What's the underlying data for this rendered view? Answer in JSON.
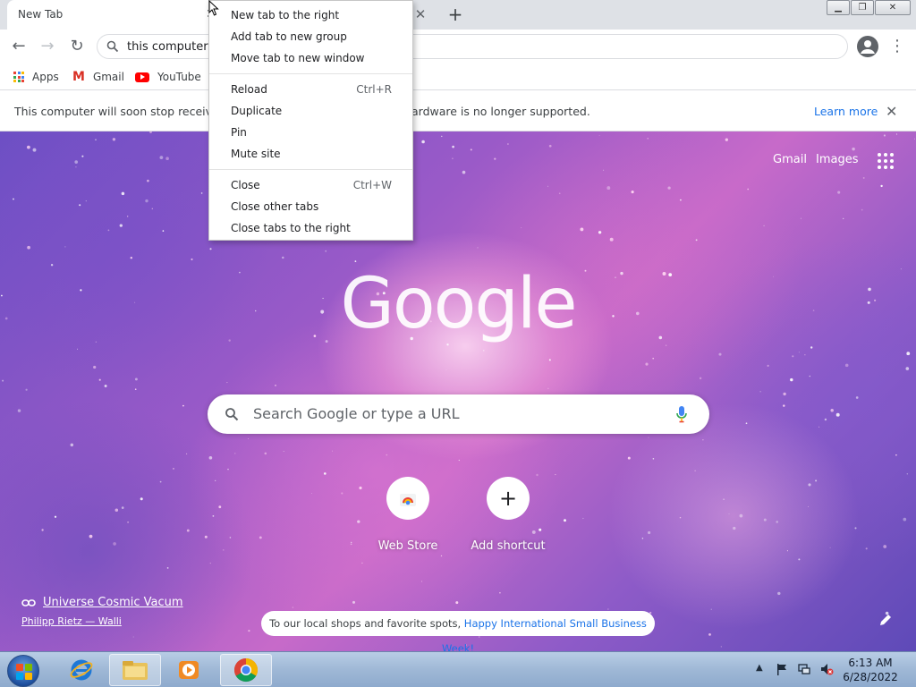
{
  "tabstrip": {
    "active_tab_title": "New Tab",
    "close_glyph": "✕",
    "second_close_glyph": "✕",
    "new_tab_glyph": "+",
    "window_controls": {
      "minimize": "▁",
      "maximize": "❐",
      "close": "✕"
    }
  },
  "toolbar": {
    "back_glyph": "←",
    "forward_glyph": "→",
    "reload_glyph": "↻",
    "omnibox_text": "this computer",
    "profile_icon": "person-icon",
    "menu_glyph": "⋮"
  },
  "bookmarks": [
    {
      "label": "Apps",
      "icon": "apps-grid-icon"
    },
    {
      "label": "Gmail",
      "icon": "gmail-icon"
    },
    {
      "label": "YouTube",
      "icon": "youtube-icon"
    }
  ],
  "infobar": {
    "text_left": "This computer will soon stop receiving",
    "text_right": "ardware is no longer supported.",
    "learn_more": "Learn more",
    "close_glyph": "✕"
  },
  "ntp": {
    "gmail_link": "Gmail",
    "images_link": "Images",
    "logo_text": "Google",
    "search_placeholder": "Search Google or type a URL",
    "shortcuts": [
      {
        "label": "Web Store",
        "icon": "web-store-icon"
      },
      {
        "label": "Add shortcut",
        "icon": "plus-icon",
        "glyph": "+"
      }
    ],
    "background_credit_title": "Universe Cosmic Vacum",
    "background_credit_author": "Philipp Rietz — Walli",
    "promo_text": "To our local shops and favorite spots, ",
    "promo_link": "Happy International Small Business Week!"
  },
  "context_menu": {
    "groups": [
      [
        {
          "label": "New tab to the right",
          "shortcut": ""
        },
        {
          "label": "Add tab to new group",
          "shortcut": ""
        },
        {
          "label": "Move tab to new window",
          "shortcut": ""
        }
      ],
      [
        {
          "label": "Reload",
          "shortcut": "Ctrl+R"
        },
        {
          "label": "Duplicate",
          "shortcut": ""
        },
        {
          "label": "Pin",
          "shortcut": ""
        },
        {
          "label": "Mute site",
          "shortcut": ""
        }
      ],
      [
        {
          "label": "Close",
          "shortcut": "Ctrl+W"
        },
        {
          "label": "Close other tabs",
          "shortcut": ""
        },
        {
          "label": "Close tabs to the right",
          "shortcut": ""
        }
      ]
    ]
  },
  "taskbar": {
    "apps": [
      "internet-explorer-icon",
      "file-explorer-icon",
      "media-player-icon",
      "chrome-icon"
    ],
    "clock_time": "6:13 AM",
    "clock_date": "6/28/2022"
  },
  "colors": {
    "accent_blue": "#1a73e8",
    "tabstrip_bg": "#dee1e6",
    "taskbar_blue": "#9fb8d6"
  }
}
